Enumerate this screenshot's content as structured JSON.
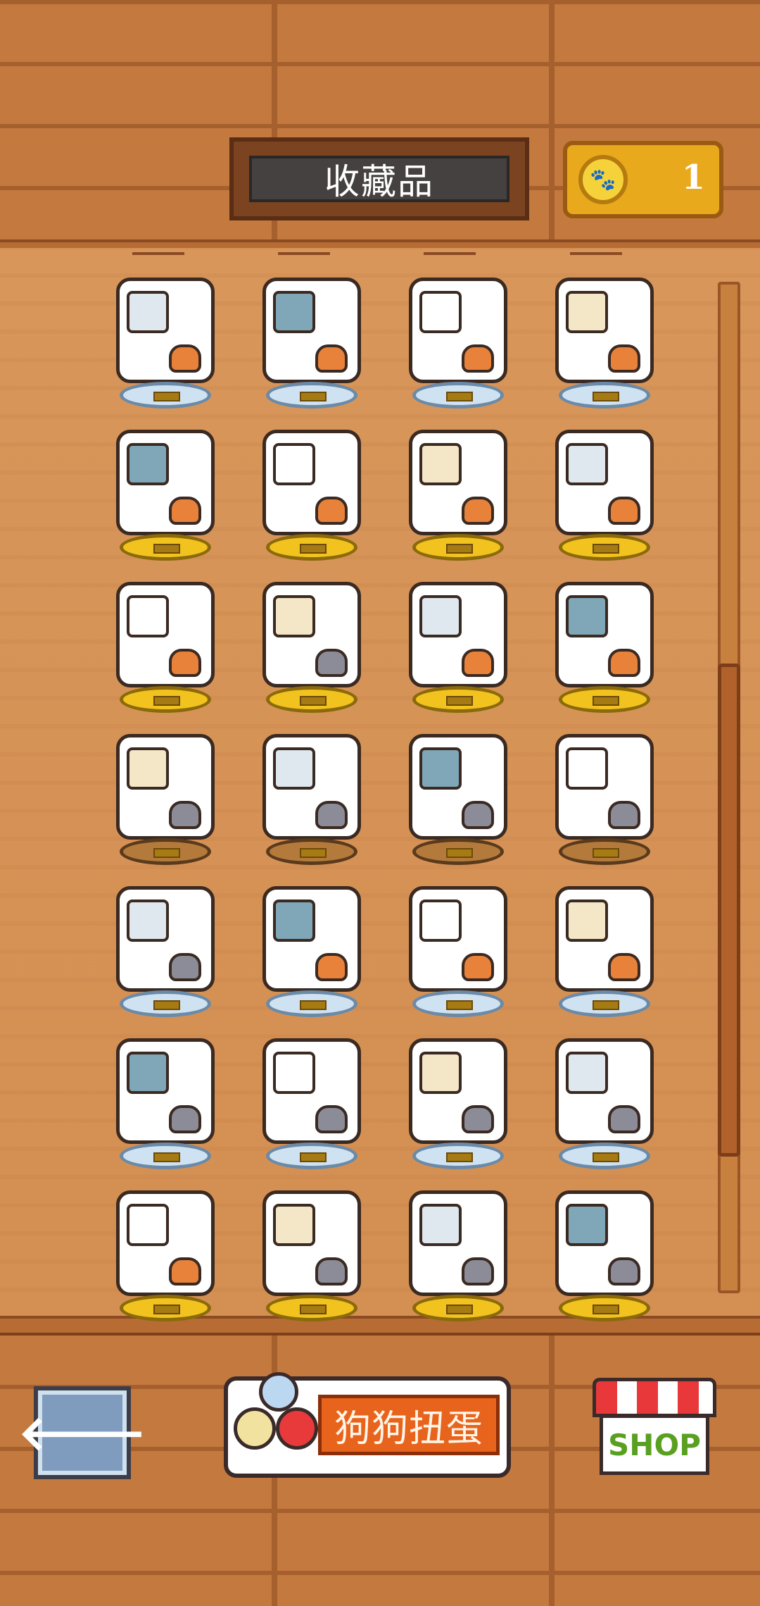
{
  "header": {
    "title": "收藏品",
    "coin_count": "1",
    "coin_icon": "paw-coin-icon"
  },
  "scrollbar": {
    "position_fraction": 0.36,
    "visible_fraction": 0.49
  },
  "collection": {
    "columns": 4,
    "rows": [
      [
        {
          "name": "boy-and-shiba",
          "base": "silver",
          "dog": "#e8823a"
        },
        {
          "name": "shiba-under-table",
          "base": "silver",
          "dog": "#e8823a"
        },
        {
          "name": "shiba-with-skewer",
          "base": "silver",
          "dog": "#e8823a"
        },
        {
          "name": "shiba-with-balls",
          "base": "silver",
          "dog": "#e8823a"
        }
      ],
      [
        {
          "name": "shiba-in-bathtub",
          "base": "gold",
          "dog": "#e8823a"
        },
        {
          "name": "shiba-mirror",
          "base": "gold",
          "dog": "#e8823a"
        },
        {
          "name": "shiba-dining",
          "base": "gold",
          "dog": "#e8823a"
        },
        {
          "name": "shiba-door",
          "base": "gold",
          "dog": "#e8823a"
        }
      ],
      [
        {
          "name": "shiba-tea-cart",
          "base": "gold",
          "dog": "#e8823a"
        },
        {
          "name": "husky-capsule-red",
          "base": "gold",
          "dog": "#8c8c98"
        },
        {
          "name": "shiba-bed",
          "base": "gold",
          "dog": "#e8823a"
        },
        {
          "name": "shiba-toy-pile",
          "base": "gold",
          "dog": "#e8823a"
        }
      ],
      [
        {
          "name": "husky-sitting",
          "base": "bronze",
          "dog": "#8c8c98"
        },
        {
          "name": "husky-lamp",
          "base": "bronze",
          "dog": "#8c8c98"
        },
        {
          "name": "husky-wardrobe",
          "base": "bronze",
          "dog": "#8c8c98"
        },
        {
          "name": "husky-plant-table",
          "base": "bronze",
          "dog": "#8c8c98"
        }
      ],
      [
        {
          "name": "husky-window",
          "base": "silver",
          "dog": "#8c8c98"
        },
        {
          "name": "shiba-husky-pair",
          "base": "silver",
          "dog": "#e8823a"
        },
        {
          "name": "shiba-husky-sofa",
          "base": "silver",
          "dog": "#e8823a"
        },
        {
          "name": "shiba-husky-round-window",
          "base": "silver",
          "dog": "#e8823a"
        }
      ],
      [
        {
          "name": "husky-door",
          "base": "silver",
          "dog": "#8c8c98"
        },
        {
          "name": "husky-armchair",
          "base": "silver",
          "dog": "#8c8c98"
        },
        {
          "name": "husky-computer",
          "base": "silver",
          "dog": "#8c8c98"
        },
        {
          "name": "husky-blue-bed",
          "base": "silver",
          "dog": "#8c8c98"
        }
      ],
      [
        {
          "name": "fireplace-pets",
          "base": "gold",
          "dog": "#e8823a"
        },
        {
          "name": "husky-shiba-dining",
          "base": "gold",
          "dog": "#8c8c98"
        },
        {
          "name": "husky-capsule-blue",
          "base": "gold",
          "dog": "#8c8c98"
        },
        {
          "name": "shiba-husky-bathtub",
          "base": "gold",
          "dog": "#8c8c98"
        }
      ]
    ]
  },
  "bottom_bar": {
    "back_label": "🡐",
    "gacha_label": "狗狗扭蛋",
    "shop_label": "SHOP"
  }
}
